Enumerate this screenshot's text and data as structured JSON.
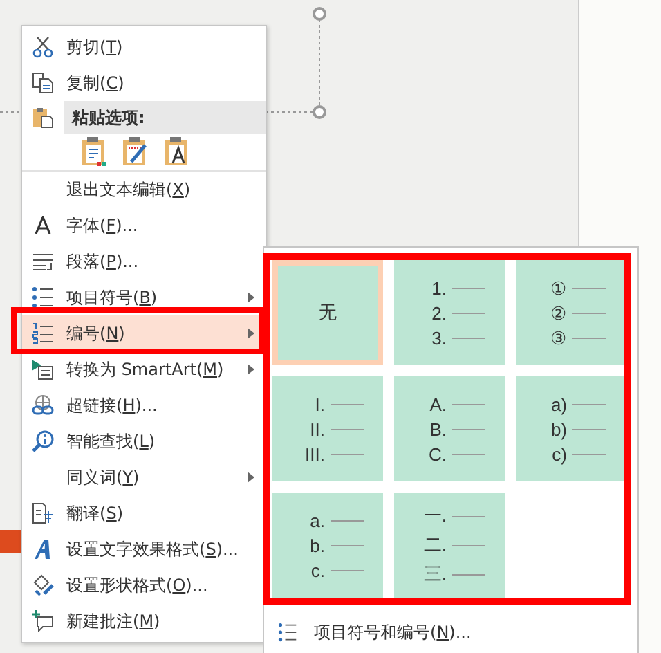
{
  "context_menu": {
    "items": [
      {
        "kind": "item",
        "before": "剪切(",
        "key": "T",
        "after": ")",
        "submenu": false,
        "selected": false
      },
      {
        "kind": "item",
        "before": "复制(",
        "key": "C",
        "after": ")",
        "submenu": false,
        "selected": false
      },
      {
        "kind": "header",
        "before": "粘贴选项:"
      },
      {
        "kind": "paste_options"
      },
      {
        "kind": "item",
        "before": "退出文本编辑(",
        "key": "X",
        "after": ")",
        "submenu": false,
        "selected": false
      },
      {
        "kind": "item",
        "before": "字体(",
        "key": "F",
        "after": ")...",
        "submenu": false,
        "selected": false
      },
      {
        "kind": "item",
        "before": "段落(",
        "key": "P",
        "after": ")...",
        "submenu": false,
        "selected": false
      },
      {
        "kind": "item",
        "before": "项目符号(",
        "key": "B",
        "after": ")",
        "submenu": true,
        "selected": false
      },
      {
        "kind": "item",
        "before": "编号(",
        "key": "N",
        "after": ")",
        "submenu": true,
        "selected": true
      },
      {
        "kind": "item",
        "before": "转换为 SmartArt(",
        "key": "M",
        "after": ")",
        "submenu": true,
        "selected": false
      },
      {
        "kind": "item",
        "before": "超链接(",
        "key": "H",
        "after": ")...",
        "submenu": false,
        "selected": false
      },
      {
        "kind": "item",
        "before": "智能查找(",
        "key": "L",
        "after": ")",
        "submenu": false,
        "selected": false
      },
      {
        "kind": "item",
        "before": "同义词(",
        "key": "Y",
        "after": ")",
        "submenu": true,
        "selected": false
      },
      {
        "kind": "item",
        "before": "翻译(",
        "key": "S",
        "after": ")",
        "submenu": false,
        "selected": false
      },
      {
        "kind": "item",
        "before": "设置文字效果格式(",
        "key": "S",
        "after": ")...",
        "submenu": false,
        "selected": false
      },
      {
        "kind": "item",
        "before": "设置形状格式(",
        "key": "O",
        "after": ")...",
        "submenu": false,
        "selected": false
      },
      {
        "kind": "item",
        "before": "新建批注(",
        "key": "M",
        "after": ")",
        "submenu": false,
        "selected": false
      }
    ]
  },
  "numbering_gallery": {
    "cells": [
      {
        "kind": "none",
        "label": "无",
        "selected": true
      },
      {
        "kind": "list",
        "markers": [
          "1.",
          "2.",
          "3."
        ],
        "selected": false
      },
      {
        "kind": "list",
        "markers": [
          "①",
          "②",
          "③"
        ],
        "selected": false
      },
      {
        "kind": "list",
        "markers": [
          "I.",
          "II.",
          "III."
        ],
        "selected": false
      },
      {
        "kind": "list",
        "markers": [
          "A.",
          "B.",
          "C."
        ],
        "selected": false
      },
      {
        "kind": "list",
        "markers": [
          "a)",
          "b)",
          "c)"
        ],
        "selected": false
      },
      {
        "kind": "list",
        "markers": [
          "a.",
          "b.",
          "c."
        ],
        "selected": false
      },
      {
        "kind": "list",
        "markers": [
          "一.",
          "二.",
          "三."
        ],
        "selected": false
      }
    ],
    "footer": {
      "before": "项目符号和编号(",
      "key": "N",
      "after": ")..."
    }
  }
}
